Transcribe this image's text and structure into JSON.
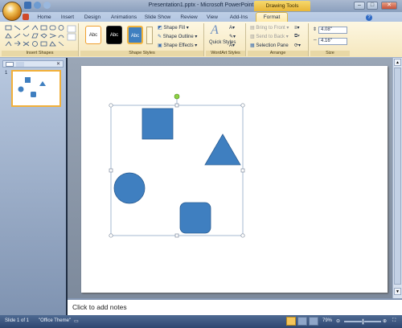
{
  "window": {
    "title": "Presentation1.pptx - Microsoft PowerPoint",
    "contextual_tab_group": "Drawing Tools",
    "minimize": "‒",
    "maximize": "□",
    "close": "✕"
  },
  "tabs": [
    {
      "label": "Home"
    },
    {
      "label": "Insert"
    },
    {
      "label": "Design"
    },
    {
      "label": "Animations"
    },
    {
      "label": "Slide Show"
    },
    {
      "label": "Review"
    },
    {
      "label": "View"
    },
    {
      "label": "Add-Ins"
    },
    {
      "label": "Format"
    }
  ],
  "ribbon": {
    "insert_shapes": {
      "label": "Insert Shapes"
    },
    "shape_styles": {
      "label": "Shape Styles",
      "swatch_text": "Abc",
      "shape_fill": "Shape Fill",
      "shape_outline": "Shape Outline",
      "shape_effects": "Shape Effects"
    },
    "wordart": {
      "label": "WordArt Styles",
      "quick_styles": "Quick Styles"
    },
    "arrange": {
      "label": "Arrange",
      "bring_to_front": "Bring to Front",
      "send_to_back": "Send to Back",
      "selection_pane": "Selection Pane"
    },
    "size": {
      "label": "Size",
      "height": "4.08\"",
      "width": "4.16\""
    }
  },
  "slides_pane": {
    "slide_number": "1"
  },
  "notes": {
    "placeholder": "Click to add notes"
  },
  "statusbar": {
    "slide_info": "Slide 1 of 1",
    "theme": "\"Office Theme\"",
    "zoom": "79%"
  },
  "colors": {
    "shape_fill": "#3f7fc0",
    "shape_stroke": "#2a5d93",
    "ribbon_bg": "#f5e7bd",
    "contextual_tab": "#f6d86c"
  }
}
